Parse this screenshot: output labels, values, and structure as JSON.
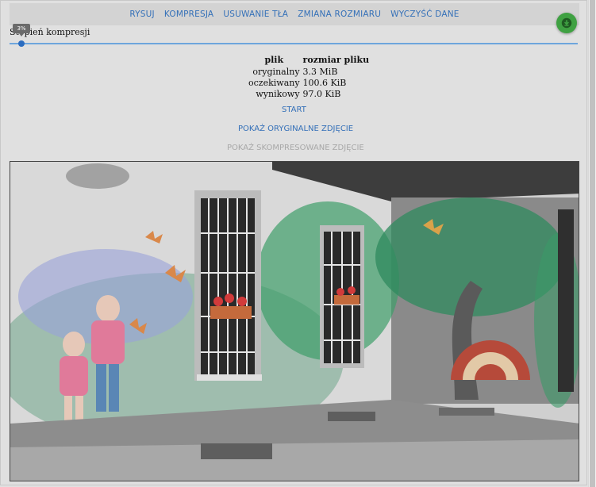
{
  "nav": {
    "items": [
      "RYSUJ",
      "KOMPRESJA",
      "USUWANIE TŁA",
      "ZMIANA ROZMIARU",
      "WYCZYŚĆ DANE"
    ]
  },
  "download": {
    "icon": "download-icon",
    "color": "#3fa142"
  },
  "slider": {
    "tooltip": "3%",
    "label": "Stopień kompresji",
    "value_percent": 3,
    "accent": "#2b6cc0"
  },
  "file_table": {
    "headers": [
      "plik",
      "rozmiar pliku"
    ],
    "rows": [
      {
        "label": "oryginalny",
        "value": "3.3 MiB"
      },
      {
        "label": "oczekiwany",
        "value": "100.6 KiB"
      },
      {
        "label": "wynikowy",
        "value": "97.0 KiB"
      }
    ]
  },
  "actions": {
    "start": "START",
    "show_original": "POKAŻ ORYGINALNE ZDJĘCIE",
    "show_compressed": "POKAŻ SKOMPRESOWANE ZDJĘCIE"
  },
  "colors": {
    "link": "#3470b8",
    "disabled": "#a8a8a8",
    "nav_bg": "#d3d3d3"
  }
}
